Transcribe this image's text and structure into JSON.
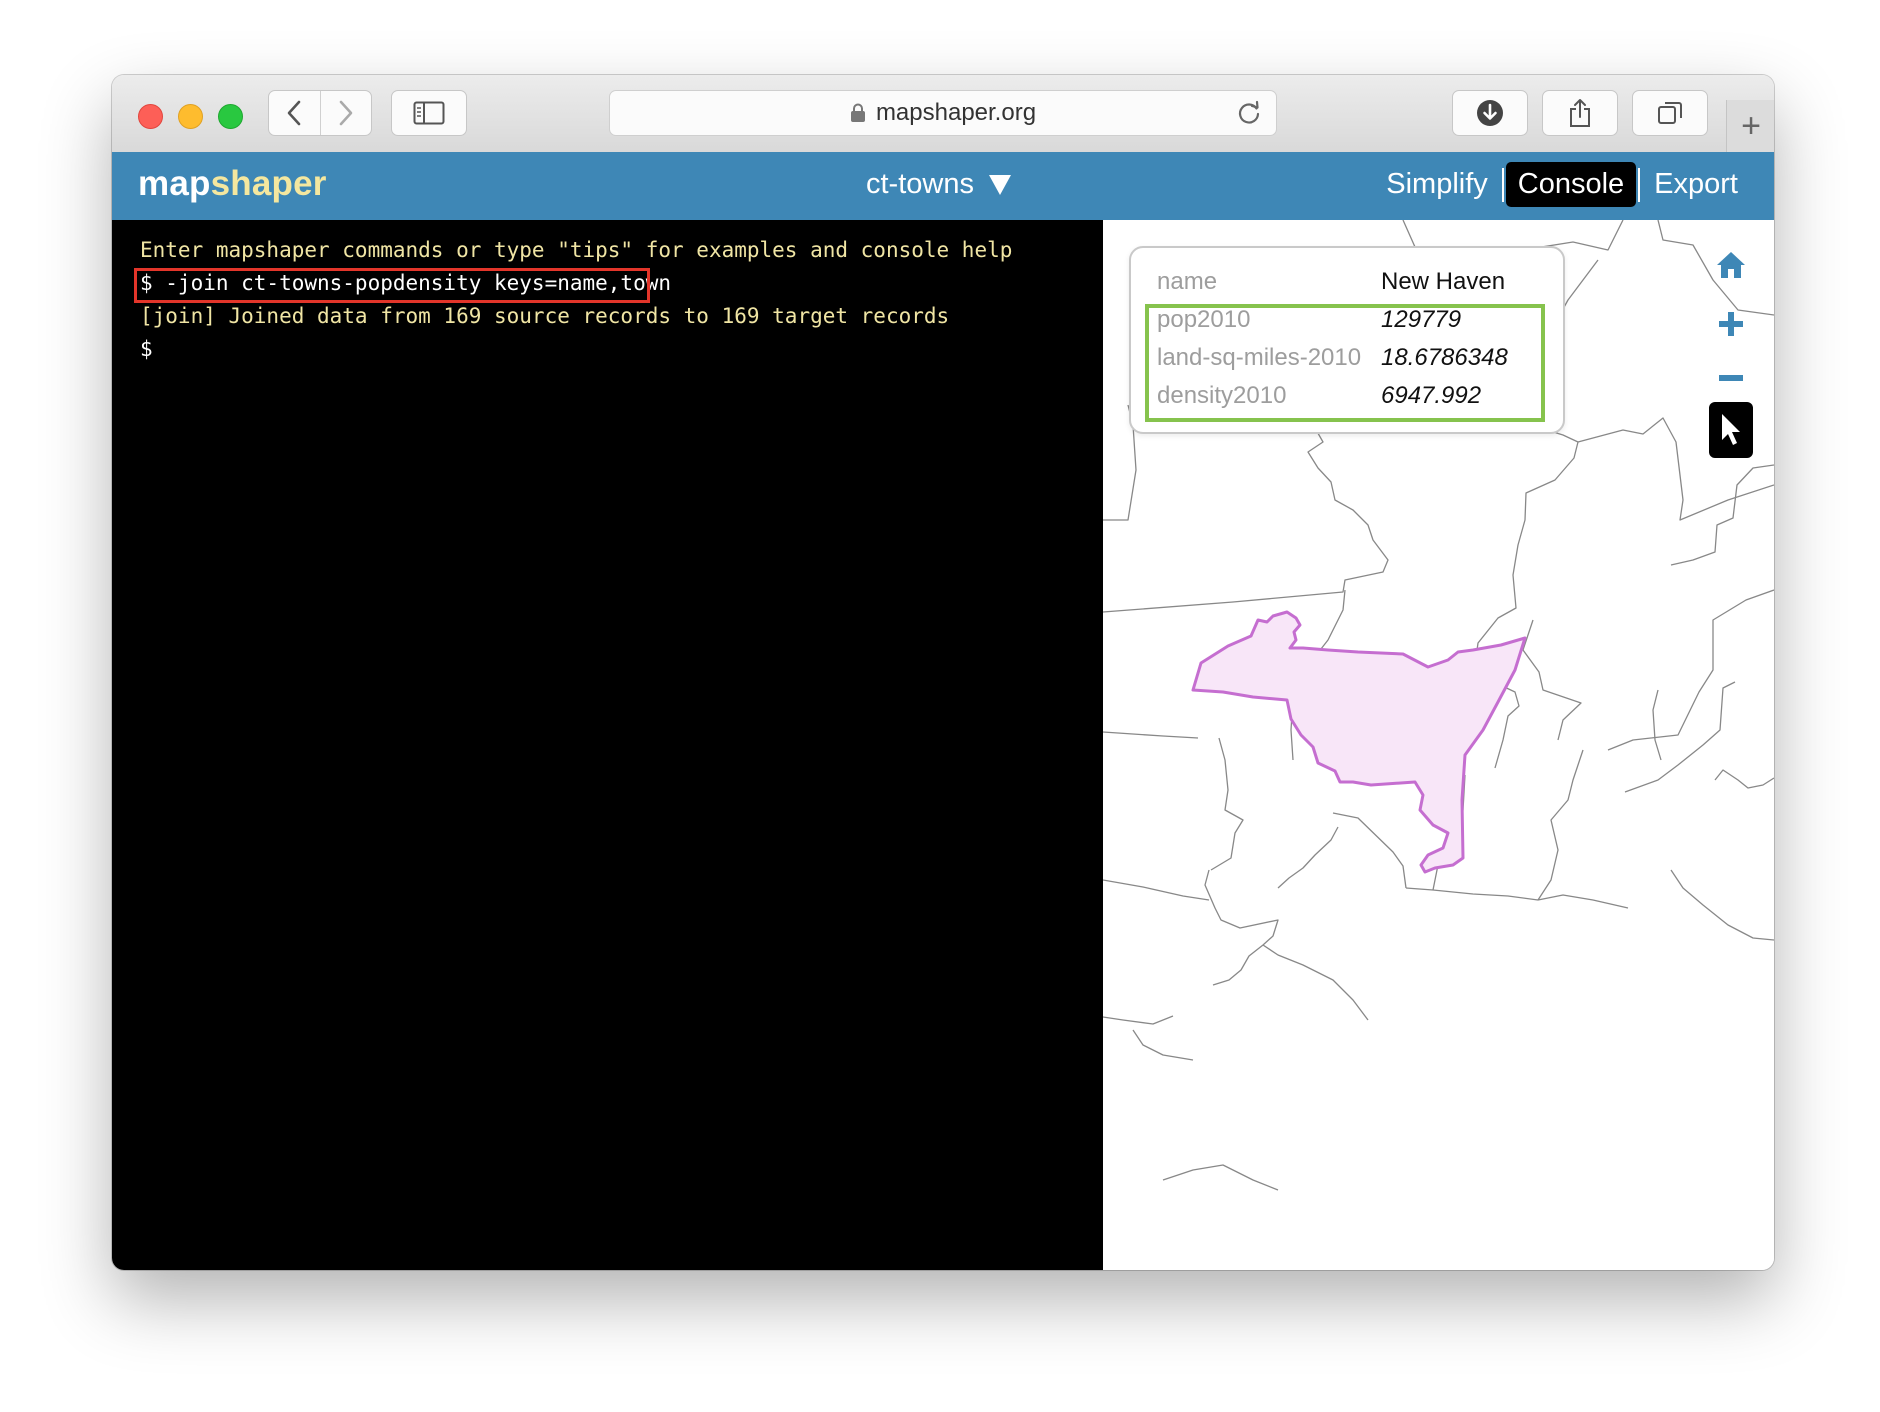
{
  "browser": {
    "url": "mapshaper.org",
    "icons": {
      "back": "chevron-left-icon",
      "forward": "chevron-right-icon",
      "sidebar": "sidebar-icon",
      "lock": "lock-icon",
      "reload": "reload-icon",
      "download": "download-icon",
      "share": "share-icon",
      "tabs": "tabs-icon",
      "new_tab": "plus-icon"
    },
    "new_tab_label": "+"
  },
  "app": {
    "logo_part1": "map",
    "logo_part2": "shaper",
    "layer_name": "ct-towns",
    "layer_menu_icon": "triangle-down-icon",
    "nav": {
      "simplify": "Simplify",
      "console": "Console",
      "export": "Export",
      "active": "Console"
    },
    "colors": {
      "header_bg": "#3e87b6",
      "logo_accent": "#f4e79f",
      "console_bg": "#000000",
      "console_text": "#f0e5a4",
      "command_highlight": "#e3352a",
      "data_highlight": "#86c34d",
      "selected_fill": "#f8e6f8",
      "selected_stroke": "#c56ed0"
    }
  },
  "console": {
    "lines": [
      "Enter mapshaper commands or type \"tips\" for examples and console help",
      "$ -join ct-towns-popdensity keys=name,town",
      "[join] Joined data from 169 source records to 169 target records",
      "$"
    ]
  },
  "popup": {
    "rows": [
      {
        "key": "name",
        "value": "New Haven"
      },
      {
        "key": "pop2010",
        "value": "129779"
      },
      {
        "key": "land-sq-miles-2010",
        "value": "18.6786348"
      },
      {
        "key": "density2010",
        "value": "6947.992"
      }
    ]
  },
  "map_controls": {
    "home": "home-icon",
    "zoom_in": "zoom-in-icon",
    "zoom_out": "zoom-out-icon",
    "pointer": "pointer-icon"
  }
}
